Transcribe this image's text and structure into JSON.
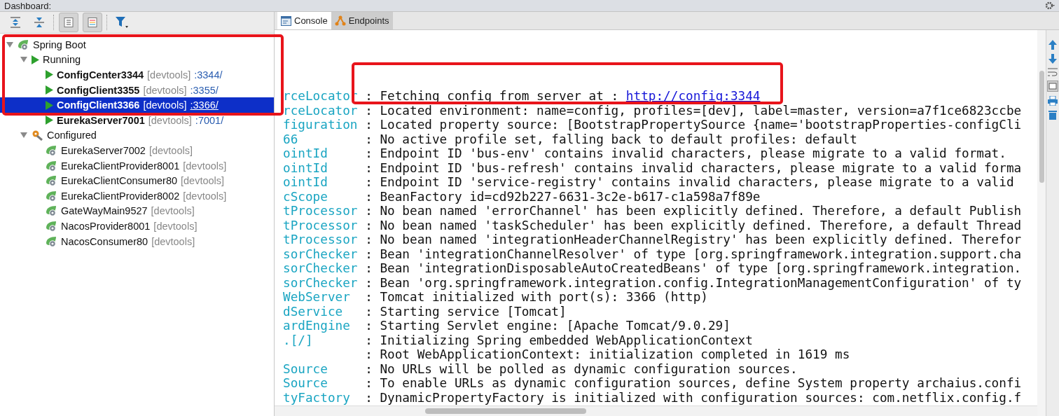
{
  "window": {
    "title": "Dashboard:"
  },
  "toolbar_toggles": [
    {
      "pressed": true
    },
    {
      "pressed": true
    }
  ],
  "tree": [
    {
      "kind": "root",
      "label": "Spring Boot",
      "expanded": true,
      "children": [
        {
          "kind": "running",
          "label": "Running",
          "expanded": true,
          "children": [
            {
              "kind": "app",
              "running": true,
              "label": "ConfigCenter3344",
              "tag": "[devtools]",
              "port": ":3344/",
              "selected": false
            },
            {
              "kind": "app",
              "running": true,
              "label": "ConfigClient3355",
              "tag": "[devtools]",
              "port": ":3355/",
              "selected": false
            },
            {
              "kind": "app",
              "running": true,
              "label": "ConfigClient3366",
              "tag": "[devtools]",
              "port": ":3366/",
              "selected": true
            },
            {
              "kind": "app",
              "running": true,
              "label": "EurekaServer7001",
              "tag": "[devtools]",
              "port": ":7001/",
              "selected": false
            }
          ]
        },
        {
          "kind": "configured",
          "label": "Configured",
          "expanded": true,
          "children": [
            {
              "kind": "app",
              "running": false,
              "label": "EurekaServer7002",
              "tag": "[devtools]",
              "selected": false
            },
            {
              "kind": "app",
              "running": false,
              "label": "EurekaClientProvider8001",
              "tag": "[devtools]",
              "selected": false
            },
            {
              "kind": "app",
              "running": false,
              "label": "EurekaClientConsumer80",
              "tag": "[devtools]",
              "selected": false
            },
            {
              "kind": "app",
              "running": false,
              "label": "EurekaClientProvider8002",
              "tag": "[devtools]",
              "selected": false
            },
            {
              "kind": "app",
              "running": false,
              "label": "GateWayMain9527",
              "tag": "[devtools]",
              "selected": false
            },
            {
              "kind": "app",
              "running": false,
              "label": "NacosProvider8001",
              "tag": "[devtools]",
              "selected": false
            },
            {
              "kind": "app",
              "running": false,
              "label": "NacosConsumer80",
              "tag": "[devtools]",
              "selected": false
            }
          ]
        }
      ]
    }
  ],
  "tabs": [
    {
      "kind": "console",
      "label": "Console",
      "selected": true
    },
    {
      "kind": "endpoints",
      "label": "Endpoints",
      "selected": false
    }
  ],
  "console": [
    {
      "source": "rceLocator",
      "message": ": Fetching config from server at : ",
      "link": "http://config:3344"
    },
    {
      "source": "rceLocator",
      "message": ": Located environment: name=config, profiles=[dev], label=master, version=a7f1ce6823ccbe"
    },
    {
      "source": "figuration",
      "message": ": Located property source: [BootstrapPropertySource {name='bootstrapProperties-configCli"
    },
    {
      "source": "66",
      "message": ": No active profile set, falling back to default profiles: default"
    },
    {
      "source": "ointId",
      "message": ": Endpoint ID 'bus-env' contains invalid characters, please migrate to a valid format."
    },
    {
      "source": "ointId",
      "message": ": Endpoint ID 'bus-refresh' contains invalid characters, please migrate to a valid forma"
    },
    {
      "source": "ointId",
      "message": ": Endpoint ID 'service-registry' contains invalid characters, please migrate to a valid"
    },
    {
      "source": "cScope",
      "message": ": BeanFactory id=cd92b227-6631-3c2e-b617-c1a598a7f89e"
    },
    {
      "source": "tProcessor",
      "message": ": No bean named 'errorChannel' has been explicitly defined. Therefore, a default Publish"
    },
    {
      "source": "tProcessor",
      "message": ": No bean named 'taskScheduler' has been explicitly defined. Therefore, a default Thread"
    },
    {
      "source": "tProcessor",
      "message": ": No bean named 'integrationHeaderChannelRegistry' has been explicitly defined. Therefor"
    },
    {
      "source": "sorChecker",
      "message": ": Bean 'integrationChannelResolver' of type [org.springframework.integration.support.cha"
    },
    {
      "source": "sorChecker",
      "message": ": Bean 'integrationDisposableAutoCreatedBeans' of type [org.springframework.integration."
    },
    {
      "source": "sorChecker",
      "message": ": Bean 'org.springframework.integration.config.IntegrationManagementConfiguration' of ty"
    },
    {
      "source": "WebServer",
      "message": ": Tomcat initialized with port(s): 3366 (http)"
    },
    {
      "source": "dService",
      "message": ": Starting service [Tomcat]"
    },
    {
      "source": "ardEngine",
      "message": ": Starting Servlet engine: [Apache Tomcat/9.0.29]"
    },
    {
      "source": ".[/]",
      "message": ": Initializing Spring embedded WebApplicationContext"
    },
    {
      "message": ": Root WebApplicationContext: initialization completed in 1619 ms"
    },
    {
      "source": "Source",
      "message": ": No URLs will be polled as dynamic configuration sources."
    },
    {
      "source": "Source",
      "message": ": To enable URLs as dynamic configuration sources, define System property archaius.confi"
    },
    {
      "source": "tyFactory",
      "message": ": DynamicPropertyFactory is initialized with configuration sources: com.netflix.config.f"
    }
  ]
}
